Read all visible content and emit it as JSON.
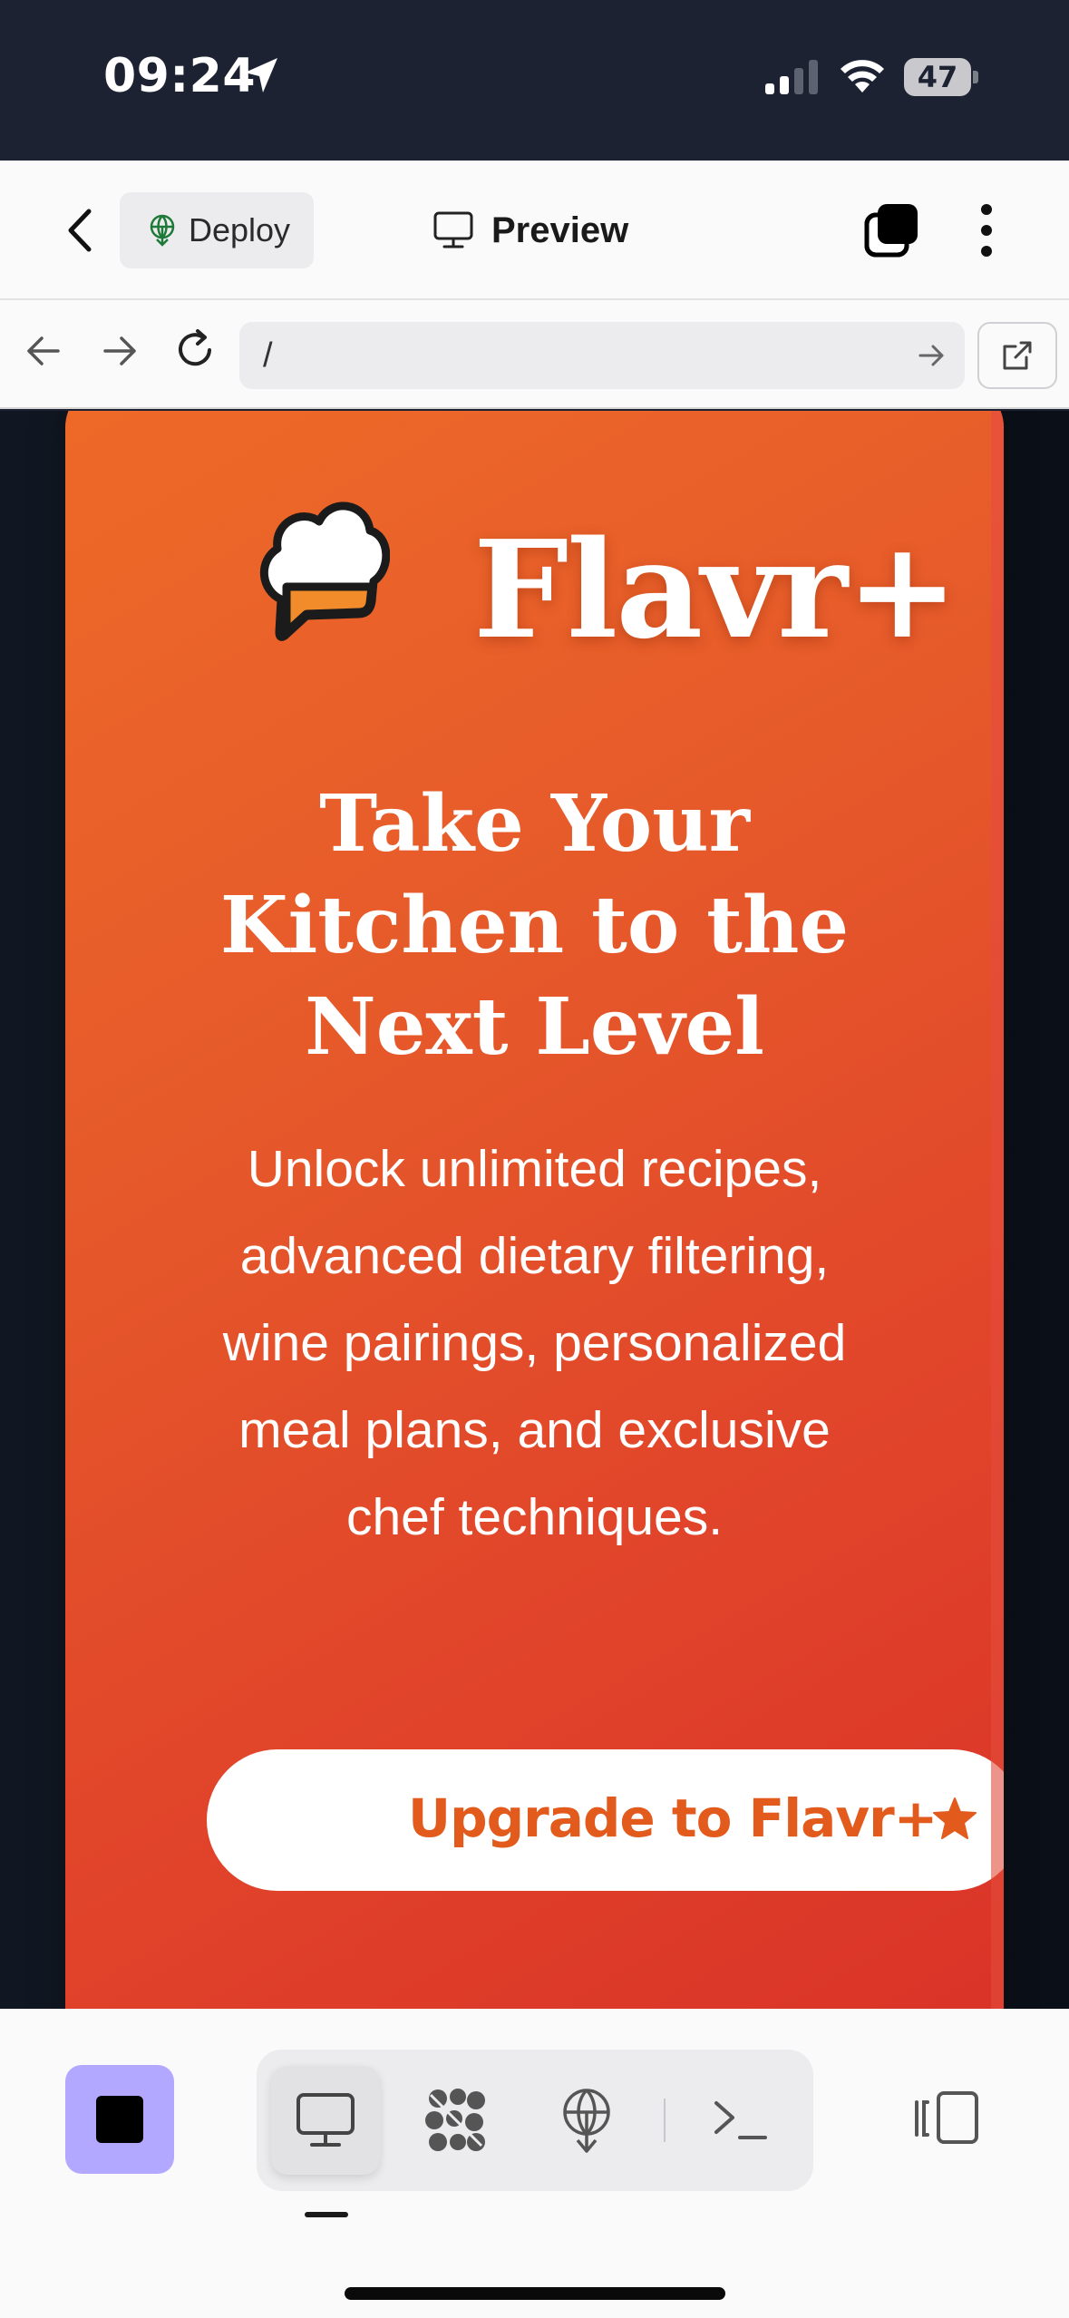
{
  "status_bar": {
    "time": "09:24",
    "battery": "47",
    "icons": [
      "location-arrow-icon",
      "signal-icon",
      "wifi-icon",
      "battery-icon"
    ]
  },
  "header": {
    "deploy_label": "Deploy",
    "preview_label": "Preview",
    "icons": [
      "chevron-left-icon",
      "deploy-globe-icon",
      "monitor-icon",
      "windows-icon",
      "kebab-menu-icon"
    ]
  },
  "url_bar": {
    "path": "/",
    "icons": [
      "arrow-left-icon",
      "arrow-right-icon",
      "reload-icon",
      "go-arrow-icon",
      "external-link-icon"
    ]
  },
  "promo": {
    "brand": "Flavr+",
    "headline": [
      "Take Your",
      "Kitchen to the",
      "Next Level"
    ],
    "description": "Unlock unlimited recipes, advanced dietary filtering, wine pairings, personalized meal plans, and exclusive chef techniques.",
    "cta_label": "Upgrade to Flavr+",
    "colors": {
      "gradient_start": "#ee6a28",
      "gradient_end": "#d93128",
      "cta_text": "#e25a1c"
    }
  },
  "toolbar": {
    "icons": [
      "stop-icon",
      "desktop-preview-icon",
      "workflow-icon",
      "deploy-icon",
      "terminal-icon",
      "panel-toggle-icon"
    ],
    "accent": "#b3a8ff"
  }
}
